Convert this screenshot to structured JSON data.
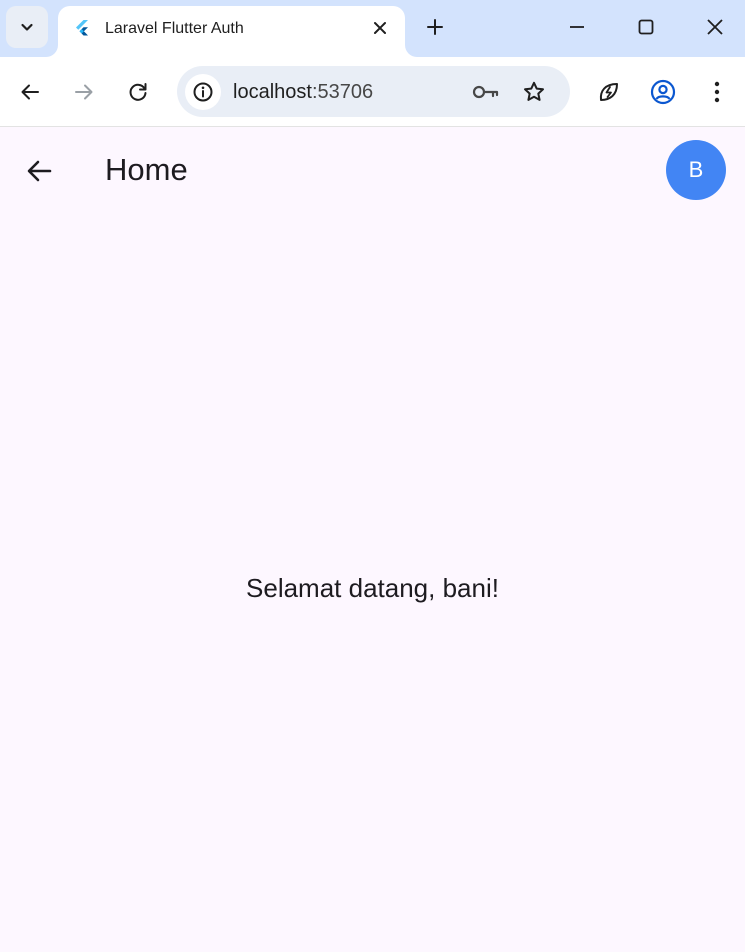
{
  "browser": {
    "tab": {
      "title": "Laravel Flutter Auth",
      "favicon": "flutter-logo"
    },
    "address": {
      "host": "localhost",
      "port": ":53706"
    },
    "icons": [
      "tab-search-icon",
      "close-icon",
      "plus-icon",
      "minimize-icon",
      "maximize-icon",
      "window-close-icon",
      "back-arrow-icon",
      "forward-arrow-icon",
      "reload-icon",
      "info-icon",
      "key-icon",
      "star-icon",
      "bolt-leaf-icon",
      "profile-icon",
      "more-vert-icon"
    ]
  },
  "app": {
    "title": "Home",
    "avatar_letter": "B",
    "welcome": "Selamat datang, bani!",
    "colors": {
      "background": "#fdf7ff",
      "avatar": "#4285f4",
      "text": "#1d1b20"
    }
  }
}
